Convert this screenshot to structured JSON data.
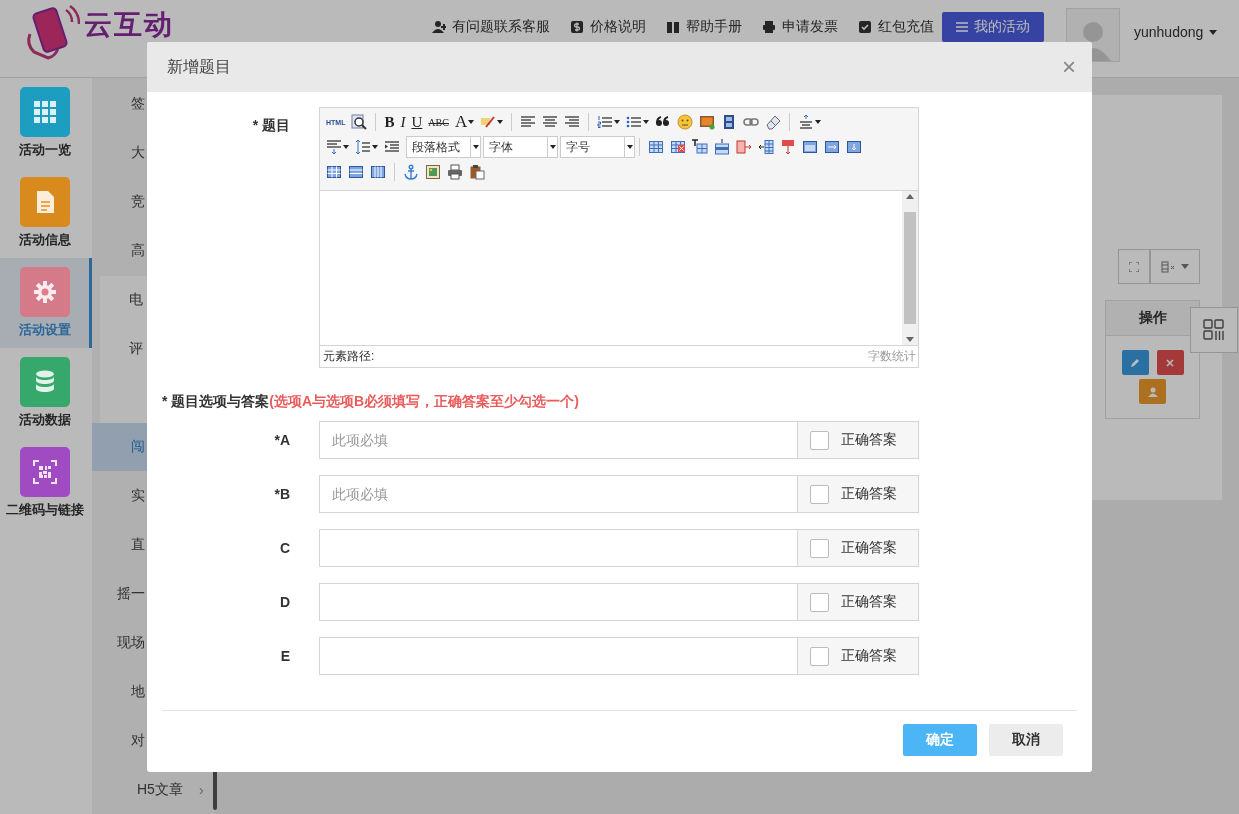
{
  "header": {
    "logo_text": "云互动",
    "nav": [
      {
        "label": "有问题联系客服"
      },
      {
        "label": "价格说明"
      },
      {
        "label": "帮助手册"
      },
      {
        "label": "申请发票"
      },
      {
        "label": "红包充值"
      }
    ],
    "primary_button": "我的活动",
    "username": "yunhudong"
  },
  "sidebar": {
    "items": [
      {
        "label": "活动一览",
        "color": "#1d9dbf",
        "selected": false
      },
      {
        "label": "活动信息",
        "color": "#d88a1d",
        "selected": false
      },
      {
        "label": "活动设置",
        "color": "#d57a89",
        "selected": true
      },
      {
        "label": "活动数据",
        "color": "#36a86c",
        "selected": false
      },
      {
        "label": "二维码与链接",
        "color": "#a04bc2",
        "selected": false
      }
    ]
  },
  "submenu": {
    "items": [
      {
        "kind": "item",
        "label": "签",
        "selected": false
      },
      {
        "kind": "item",
        "label": "大",
        "selected": false
      },
      {
        "kind": "item",
        "label": "竞",
        "selected": false
      },
      {
        "kind": "item",
        "label": "高",
        "selected": false
      },
      {
        "kind": "group",
        "children": [
          {
            "label": "电",
            "selected": false
          },
          {
            "label": "评",
            "selected": false
          }
        ]
      },
      {
        "kind": "item",
        "label": "闯",
        "selected": true
      },
      {
        "kind": "item",
        "label": "实",
        "selected": false
      },
      {
        "kind": "item",
        "label": "直",
        "selected": false
      },
      {
        "kind": "item",
        "label": "摇一",
        "selected": false
      },
      {
        "kind": "item",
        "label": "现场",
        "selected": false
      },
      {
        "kind": "item",
        "label": "地",
        "selected": false
      },
      {
        "kind": "item",
        "label": "对",
        "selected": false
      },
      {
        "kind": "item",
        "label": "H5文章",
        "selected": false,
        "arrow": "›"
      }
    ]
  },
  "table": {
    "columns": [
      "操作"
    ]
  },
  "dialog": {
    "title": "新增题目",
    "close": "×",
    "question_label": "* 题目",
    "editor": {
      "toolbar_labels": [
        "HTML",
        "B",
        "I",
        "U",
        "ABC",
        "A"
      ],
      "selects": [
        "段落格式",
        "字体",
        "字号"
      ],
      "path_label": "元素路径:",
      "word_count": "字数统计"
    },
    "options_heading": "* 题目选项与答案",
    "options_note": "(选项A与选项B必须填写，正确答案至少勾选一个)",
    "options": [
      {
        "label": "*A",
        "placeholder": "此项必填",
        "answer_label": "正确答案",
        "checked": false
      },
      {
        "label": "*B",
        "placeholder": "此项必填",
        "answer_label": "正确答案",
        "checked": false
      },
      {
        "label": "C",
        "answer_label": "正确答案",
        "checked": false
      },
      {
        "label": "D",
        "answer_label": "正确答案",
        "checked": false
      },
      {
        "label": "E",
        "answer_label": "正确答案",
        "checked": false
      }
    ],
    "buttons": [
      {
        "label": "确定",
        "kind": "primary"
      },
      {
        "label": "取消",
        "kind": "default"
      }
    ]
  }
}
